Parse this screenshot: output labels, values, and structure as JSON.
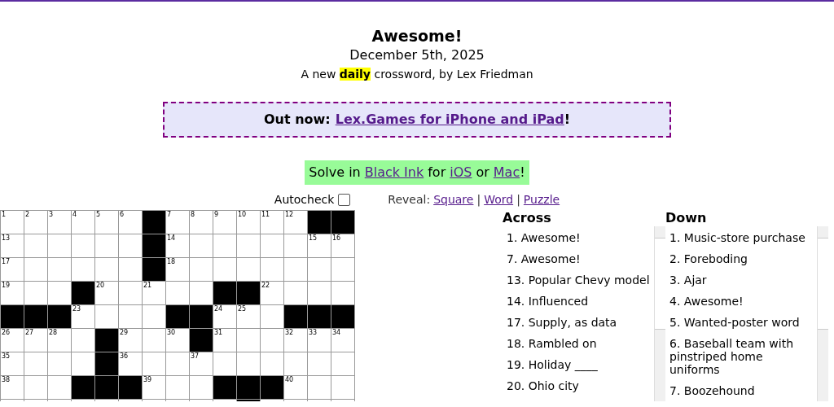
{
  "title": "Awesome!",
  "date": "December 5th, 2025",
  "byline": "A new **daily** crossword, by Lex Friedman",
  "banner": {
    "prefix": "Out now:",
    "link": "Lex.Games for iPhone and iPad",
    "suffix": "!"
  },
  "promo": {
    "parts": [
      {
        "kind": "text",
        "text": "Solve in"
      },
      {
        "kind": "link",
        "text": "Black Ink"
      },
      {
        "kind": "text",
        "text": "for"
      },
      {
        "kind": "link",
        "text": "iOS"
      },
      {
        "kind": "text",
        "text": "or"
      },
      {
        "kind": "link",
        "text": "Mac"
      },
      {
        "kind": "text",
        "text": "!"
      }
    ]
  },
  "autocheck": {
    "label": "Autocheck",
    "checked": false
  },
  "reveal": {
    "label": "Reveal:",
    "parts": [
      {
        "kind": "link",
        "text": "Square"
      },
      {
        "kind": "text",
        "text": "|"
      },
      {
        "kind": "link",
        "text": "Word"
      },
      {
        "kind": "text",
        "text": "|"
      },
      {
        "kind": "link",
        "text": "Puzzle"
      }
    ]
  },
  "grid": [
    [
      {
        "block": false,
        "number": "1"
      },
      {
        "block": false,
        "number": "2"
      },
      {
        "block": false,
        "number": "3"
      },
      {
        "block": false,
        "number": "4"
      },
      {
        "block": false,
        "number": "5"
      },
      {
        "block": false,
        "number": "6"
      },
      {
        "block": true
      },
      {
        "block": false,
        "number": "7"
      },
      {
        "block": false,
        "number": "8"
      },
      {
        "block": false,
        "number": "9"
      },
      {
        "block": false,
        "number": "10"
      },
      {
        "block": false,
        "number": "11"
      },
      {
        "block": false,
        "number": "12"
      },
      {
        "block": true
      },
      {
        "block": true
      }
    ],
    [
      {
        "block": false,
        "number": "13"
      },
      {
        "block": false
      },
      {
        "block": false
      },
      {
        "block": false
      },
      {
        "block": false
      },
      {
        "block": false
      },
      {
        "block": true
      },
      {
        "block": false,
        "number": "14"
      },
      {
        "block": false
      },
      {
        "block": false
      },
      {
        "block": false
      },
      {
        "block": false
      },
      {
        "block": false
      },
      {
        "block": false,
        "number": "15"
      },
      {
        "block": false,
        "number": "16"
      }
    ],
    [
      {
        "block": false,
        "number": "17"
      },
      {
        "block": false
      },
      {
        "block": false
      },
      {
        "block": false
      },
      {
        "block": false
      },
      {
        "block": false
      },
      {
        "block": true
      },
      {
        "block": false,
        "number": "18"
      },
      {
        "block": false
      },
      {
        "block": false
      },
      {
        "block": false
      },
      {
        "block": false
      },
      {
        "block": false
      },
      {
        "block": false
      },
      {
        "block": false
      }
    ],
    [
      {
        "block": false,
        "number": "19"
      },
      {
        "block": false
      },
      {
        "block": false
      },
      {
        "block": true
      },
      {
        "block": false,
        "number": "20"
      },
      {
        "block": false
      },
      {
        "block": false,
        "number": "21"
      },
      {
        "block": false
      },
      {
        "block": false
      },
      {
        "block": true
      },
      {
        "block": true
      },
      {
        "block": false,
        "number": "22"
      },
      {
        "block": false
      },
      {
        "block": false
      },
      {
        "block": false
      }
    ],
    [
      {
        "block": true
      },
      {
        "block": true
      },
      {
        "block": true
      },
      {
        "block": false,
        "number": "23"
      },
      {
        "block": false
      },
      {
        "block": false
      },
      {
        "block": false
      },
      {
        "block": true
      },
      {
        "block": true
      },
      {
        "block": false,
        "number": "24"
      },
      {
        "block": false,
        "number": "25"
      },
      {
        "block": false
      },
      {
        "block": true
      },
      {
        "block": true
      },
      {
        "block": true
      }
    ],
    [
      {
        "block": false,
        "number": "26"
      },
      {
        "block": false,
        "number": "27"
      },
      {
        "block": false,
        "number": "28"
      },
      {
        "block": false
      },
      {
        "block": true
      },
      {
        "block": false,
        "number": "29"
      },
      {
        "block": false
      },
      {
        "block": false,
        "number": "30"
      },
      {
        "block": true
      },
      {
        "block": false,
        "number": "31"
      },
      {
        "block": false
      },
      {
        "block": false
      },
      {
        "block": false,
        "number": "32"
      },
      {
        "block": false,
        "number": "33"
      },
      {
        "block": false,
        "number": "34"
      }
    ],
    [
      {
        "block": false,
        "number": "35"
      },
      {
        "block": false
      },
      {
        "block": false
      },
      {
        "block": false
      },
      {
        "block": true
      },
      {
        "block": false,
        "number": "36"
      },
      {
        "block": false
      },
      {
        "block": false
      },
      {
        "block": false,
        "number": "37"
      },
      {
        "block": false
      },
      {
        "block": false
      },
      {
        "block": false
      },
      {
        "block": false
      },
      {
        "block": false
      },
      {
        "block": false
      }
    ],
    [
      {
        "block": false,
        "number": "38"
      },
      {
        "block": false
      },
      {
        "block": false
      },
      {
        "block": true
      },
      {
        "block": true
      },
      {
        "block": true
      },
      {
        "block": false,
        "number": "39"
      },
      {
        "block": false
      },
      {
        "block": false
      },
      {
        "block": true
      },
      {
        "block": true
      },
      {
        "block": true
      },
      {
        "block": false,
        "number": "40"
      },
      {
        "block": false
      },
      {
        "block": false
      }
    ],
    [
      {
        "block": false
      },
      {
        "block": false
      },
      {
        "block": false
      },
      {
        "block": false
      },
      {
        "block": false
      },
      {
        "block": false
      },
      {
        "block": false
      },
      {
        "block": false
      },
      {
        "block": false
      },
      {
        "block": false
      },
      {
        "block": true
      },
      {
        "block": false
      },
      {
        "block": false
      },
      {
        "block": false
      },
      {
        "block": false
      }
    ]
  ],
  "across": {
    "heading": "Across",
    "clues": [
      "1. Awesome!",
      "7. Awesome!",
      "13. Popular Chevy model",
      "14. Influenced",
      "17. Supply, as data",
      "18. Rambled on",
      "19. Holiday ____",
      "20. Ohio city"
    ]
  },
  "down": {
    "heading": "Down",
    "clues": [
      "1. Music-store purchase",
      "2. Foreboding",
      "3. Ajar",
      "4. Awesome!",
      "5. Wanted-poster word",
      "6. Baseball team with pinstriped home uniforms",
      "7. Boozehound"
    ]
  }
}
